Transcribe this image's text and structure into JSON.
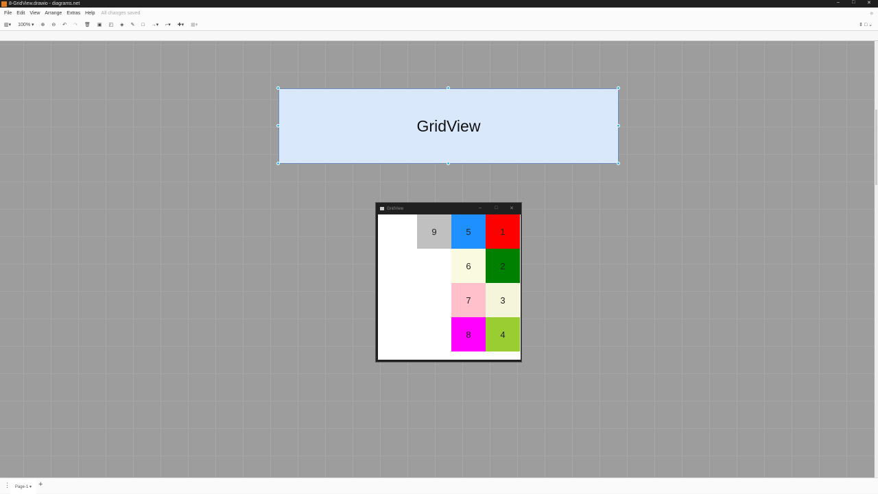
{
  "window": {
    "title": "8-GridView.drawio - diagrams.net",
    "min": "–",
    "max": "□",
    "close": "✕"
  },
  "menu": {
    "items": [
      "File",
      "Edit",
      "View",
      "Arrange",
      "Extras",
      "Help"
    ],
    "status": "All changes saved"
  },
  "toolbar": {
    "zoom": "100%",
    "icons": [
      "format-panel-icon",
      "zoom-in-icon",
      "zoom-out-icon",
      "undo-icon",
      "redo-icon",
      "delete-icon",
      "to-front-icon",
      "to-back-icon",
      "fill-color-icon",
      "line-color-icon",
      "shadow-icon",
      "connection-icon",
      "waypoints-icon",
      "insert-icon",
      "table-icon"
    ]
  },
  "shape": {
    "label": "GridView",
    "fill": "#dae8fc"
  },
  "app_window": {
    "title": "GridView",
    "cells": [
      {
        "label": "9",
        "color": "#c0c0c0"
      },
      {
        "label": "5",
        "color": "#1e90ff"
      },
      {
        "label": "1",
        "color": "#ff0000"
      },
      {
        "label": "6",
        "color": "#fafae0"
      },
      {
        "label": "2",
        "color": "#008000"
      },
      {
        "label": "7",
        "color": "#ffc0cb"
      },
      {
        "label": "3",
        "color": "#f5f5dc"
      },
      {
        "label": "8",
        "color": "#ff00ff"
      },
      {
        "label": "4",
        "color": "#9acd32"
      }
    ]
  },
  "footer": {
    "page_tab": "Page-1",
    "add_page": "+",
    "menu": "⋮"
  }
}
